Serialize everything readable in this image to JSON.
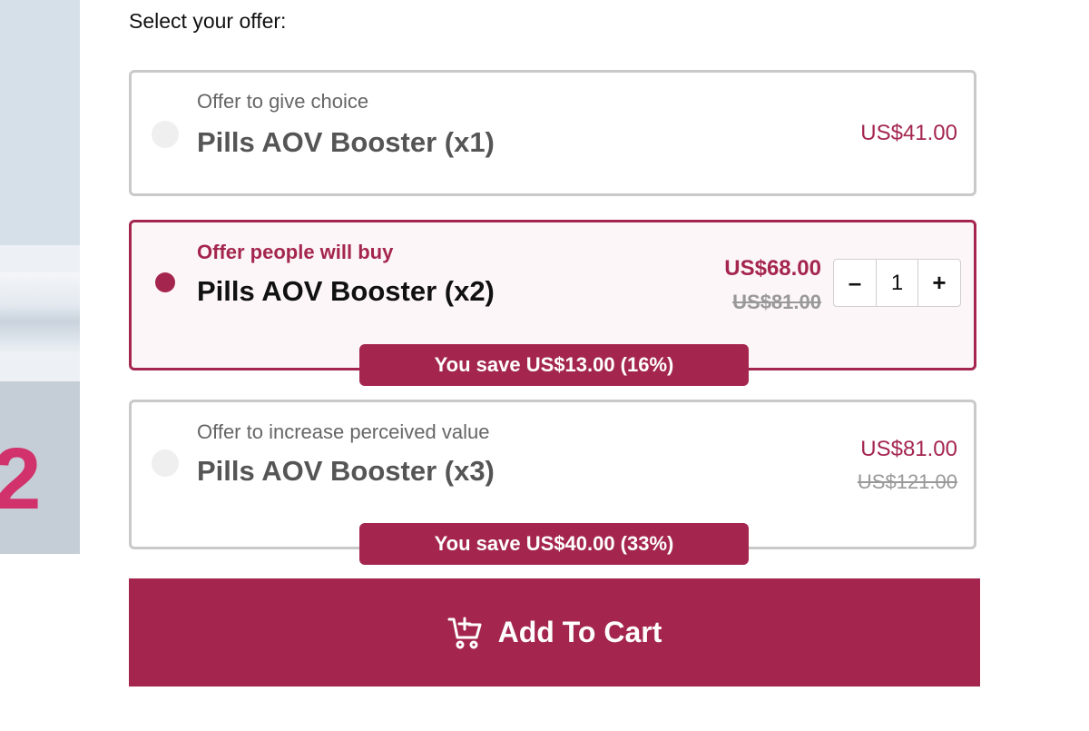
{
  "heading": "Select your offer:",
  "product_image": {
    "visible_text": "2"
  },
  "offers": [
    {
      "subtitle": "Offer to give choice",
      "title": "Pills AOV Booster (x1)",
      "price": "US$41.00",
      "selected": false
    },
    {
      "subtitle": "Offer people will buy",
      "title": "Pills AOV Booster (x2)",
      "price": "US$68.00",
      "compare_price": "US$81.00",
      "selected": true,
      "quantity": {
        "minus": "–",
        "value": "1",
        "plus": "+"
      },
      "savings": "You save US$13.00 (16%)"
    },
    {
      "subtitle": "Offer to increase perceived value",
      "title": "Pills AOV Booster (x3)",
      "price": "US$81.00",
      "compare_price": "US$121.00",
      "selected": false,
      "savings": "You save US$40.00 (33%)"
    }
  ],
  "cart_button": {
    "label": "Add To Cart",
    "icon": "cart-plus-icon"
  },
  "colors": {
    "accent": "#a4264f",
    "border": "#c9c9c9",
    "selected_bg": "#fdf6f8"
  }
}
